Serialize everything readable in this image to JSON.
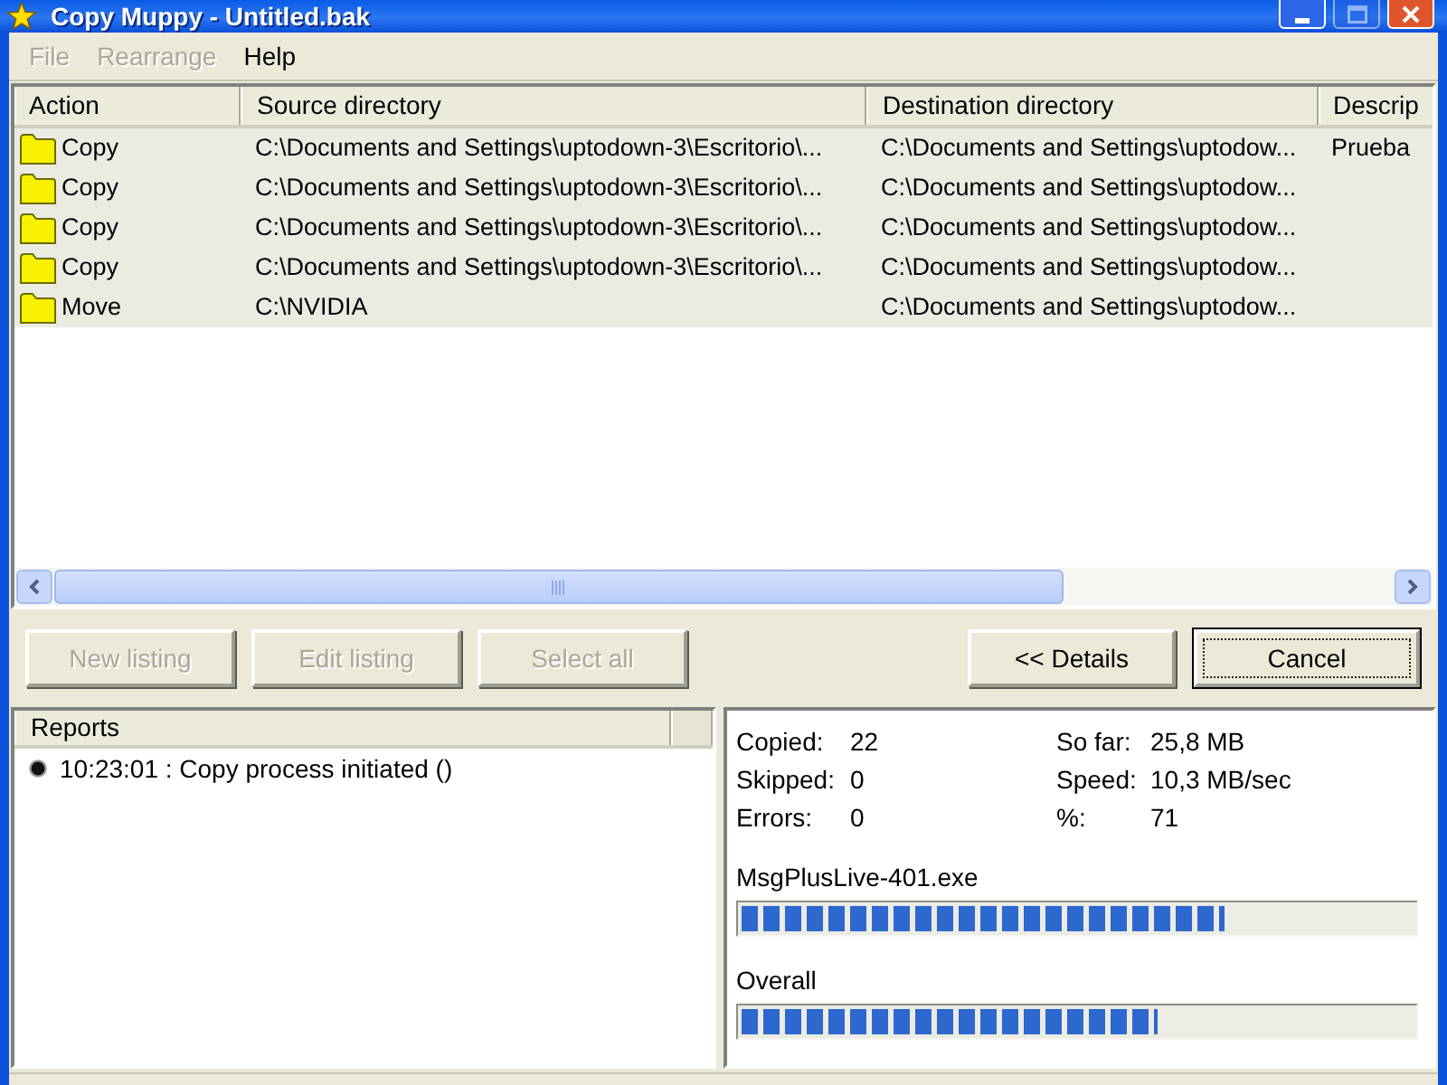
{
  "window": {
    "title": "Copy Muppy - Untitled.bak",
    "controls": [
      {
        "kind": "minimize",
        "disabled": false
      },
      {
        "kind": "maximize",
        "disabled": true
      },
      {
        "kind": "close",
        "disabled": false
      }
    ]
  },
  "menu": [
    {
      "label": "File",
      "disabled": true
    },
    {
      "label": "Rearrange",
      "disabled": true
    },
    {
      "label": "Help",
      "disabled": false
    }
  ],
  "table": {
    "columns": [
      "Action",
      "Source directory",
      "Destination directory",
      "Descrip"
    ],
    "rows": [
      {
        "selected": true,
        "cells": [
          "Copy",
          "C:\\Documents and Settings\\uptodown-3\\Escritorio\\...",
          "C:\\Documents and Settings\\uptodow...",
          "Prueba"
        ]
      },
      {
        "selected": true,
        "cells": [
          "Copy",
          "C:\\Documents and Settings\\uptodown-3\\Escritorio\\...",
          "C:\\Documents and Settings\\uptodow..."
        ]
      },
      {
        "selected": true,
        "cells": [
          "Copy",
          "C:\\Documents and Settings\\uptodown-3\\Escritorio\\...",
          "C:\\Documents and Settings\\uptodow..."
        ]
      },
      {
        "selected": true,
        "cells": [
          "Copy",
          "C:\\Documents and Settings\\uptodown-3\\Escritorio\\...",
          "C:\\Documents and Settings\\uptodow..."
        ]
      },
      {
        "selected": true,
        "cells": [
          "Move",
          "C:\\NVIDIA",
          "C:\\Documents and Settings\\uptodow..."
        ]
      }
    ]
  },
  "listing_buttons": [
    {
      "label": "New listing",
      "disabled": true
    },
    {
      "label": "Edit listing",
      "disabled": true
    },
    {
      "label": "Select all",
      "disabled": true
    }
  ],
  "dialog_buttons": [
    {
      "label": "<< Details",
      "disabled": false,
      "default": false
    },
    {
      "label": "Cancel",
      "disabled": false,
      "default": true
    }
  ],
  "reports": {
    "columns": [
      "Reports"
    ],
    "items": [
      {
        "text": "10:23:01 : Copy process initiated ()"
      }
    ]
  },
  "stats": {
    "left": [
      {
        "label": "Copied:",
        "value": "22"
      },
      {
        "label": "Skipped:",
        "value": "0"
      },
      {
        "label": "Errors:",
        "value": "0"
      }
    ],
    "right": [
      {
        "label": "So far:",
        "value": "25,8 MB"
      },
      {
        "label": "Speed:",
        "value": "10,3 MB/sec"
      },
      {
        "label": "%:",
        "value": "71"
      }
    ]
  },
  "progress": [
    {
      "label": "MsgPlusLive-401.exe",
      "level": 0.72
    },
    {
      "label": "Overall",
      "level": 0.62
    }
  ]
}
